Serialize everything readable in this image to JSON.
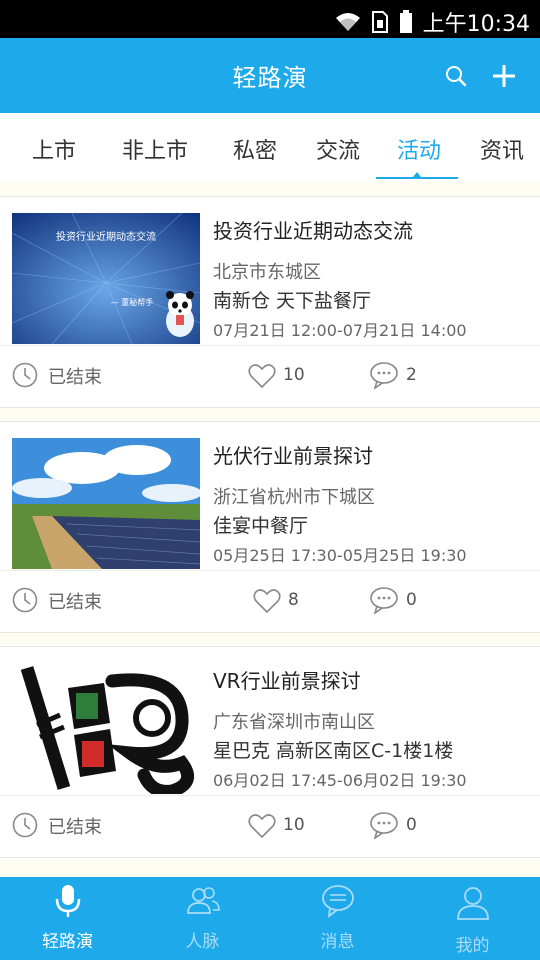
{
  "status_bar": {
    "time": "上午10:34"
  },
  "header": {
    "title": "轻路演"
  },
  "tabs": [
    {
      "label": "上市"
    },
    {
      "label": "非上市"
    },
    {
      "label": "私密"
    },
    {
      "label": "交流"
    },
    {
      "label": "活动",
      "active": true
    },
    {
      "label": "资讯"
    }
  ],
  "events": [
    {
      "image_caption": "投资行业近期动态交流",
      "image_signature": "— 董秘帮手",
      "title": "投资行业近期动态交流",
      "location_line1": "北京市东城区",
      "location_line2": "南新仓 天下盐餐厅",
      "time": "07月21日 12:00-07月21日 14:00",
      "status": "已结束",
      "likes": "10",
      "comments": "2"
    },
    {
      "title": "光伏行业前景探讨",
      "location_line1": "浙江省杭州市下城区",
      "location_line2": "佳宴中餐厅",
      "time": "05月25日 17:30-05月25日 19:30",
      "status": "已结束",
      "likes": "8",
      "comments": "0"
    },
    {
      "title": "VR行业前景探讨",
      "location_line1": "广东省深圳市南山区",
      "location_line2": "星巴克  高新区南区C-1楼1楼",
      "time": "06月02日 17:45-06月02日 19:30",
      "status": "已结束",
      "likes": "10",
      "comments": "0"
    }
  ],
  "bottom_nav": [
    {
      "label": "轻路演",
      "icon": "microphone-icon",
      "active": true
    },
    {
      "label": "人脉",
      "icon": "contacts-icon"
    },
    {
      "label": "消息",
      "icon": "message-icon"
    },
    {
      "label": "我的",
      "icon": "profile-icon"
    }
  ],
  "colors": {
    "accent": "#1ea9eb",
    "list_background": "#fdfdf2"
  }
}
